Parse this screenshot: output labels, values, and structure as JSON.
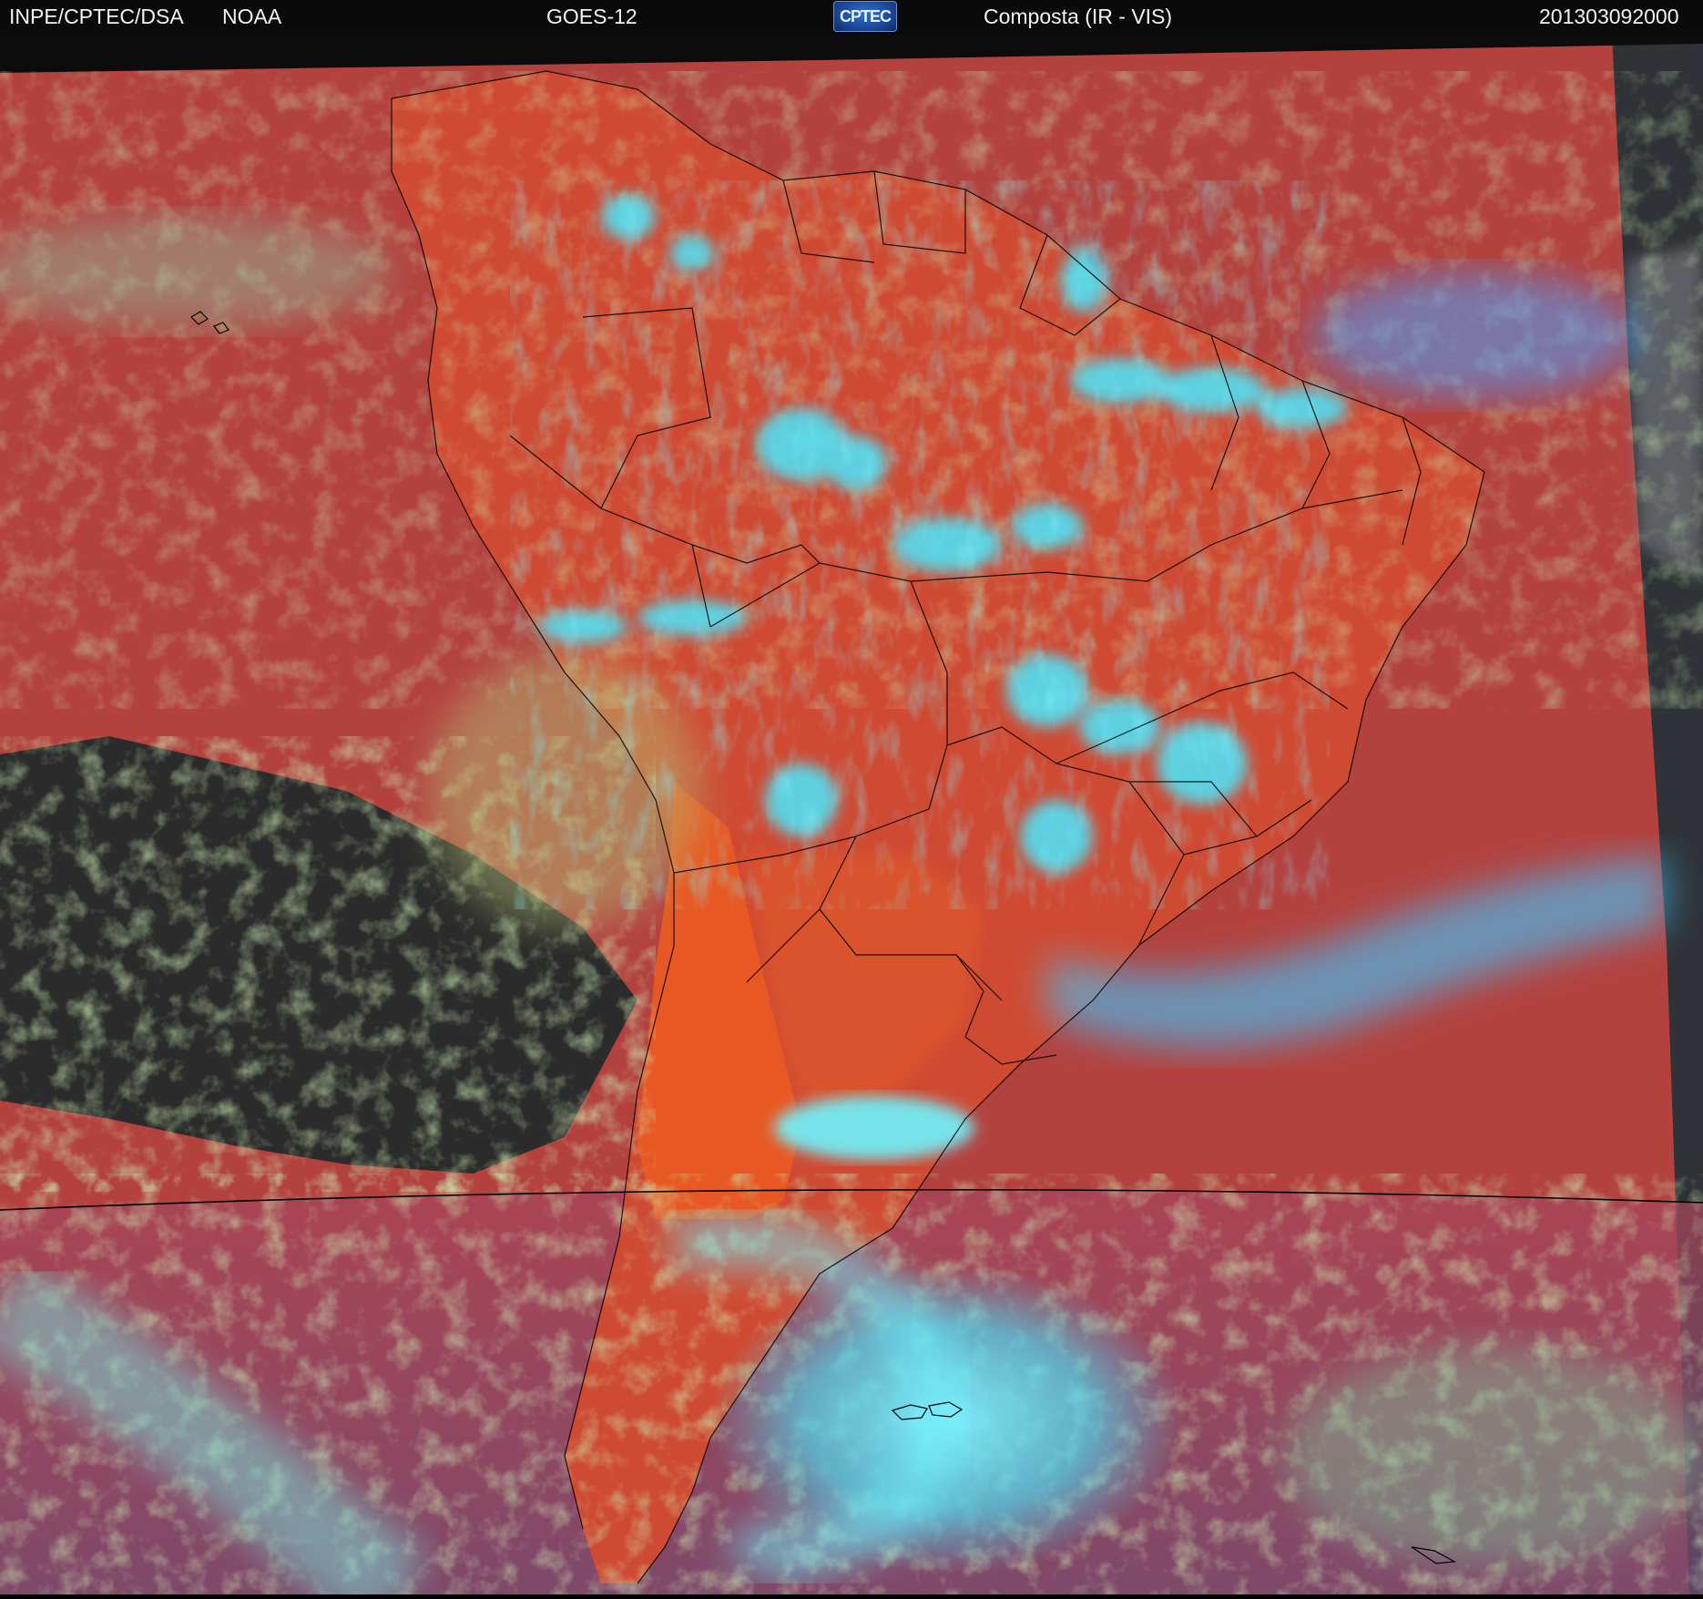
{
  "header": {
    "agency": "INPE/CPTEC/DSA",
    "partner": "NOAA",
    "satellite": "GOES-12",
    "logo_text": "CPTEC",
    "product": "Composta (IR - VIS)",
    "timestamp": "201303092000"
  },
  "colors": {
    "background_ocean": "#b8433f",
    "warm_land": "#e0502a",
    "low_cloud": "#9fcf6a",
    "high_cloud": "#3fe6ff",
    "clear_dark": "#2a2a2a",
    "night_side": "#3a3a3a",
    "border_lines": "#000000"
  },
  "map": {
    "region": "South America",
    "projection_icon": "satellite-composite-image",
    "shows_political_borders": true,
    "shows_terminator_line": true
  }
}
